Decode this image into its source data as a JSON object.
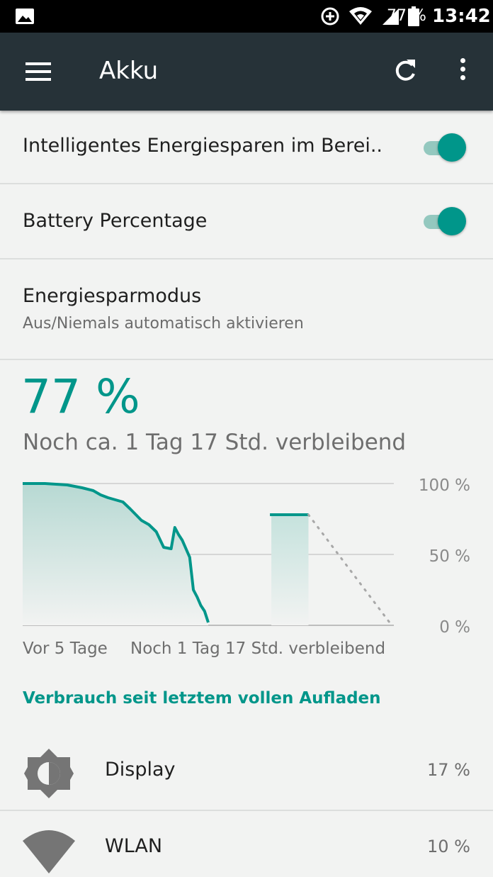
{
  "status_bar": {
    "battery_percent": "77 %",
    "time": "13:42",
    "icons": [
      "image-icon",
      "data-saver-icon",
      "wifi-icon",
      "signal-icon",
      "battery-icon"
    ]
  },
  "app_bar": {
    "title": "Akku",
    "icons": [
      "menu-icon",
      "refresh-icon",
      "more-vert-icon"
    ]
  },
  "settings": {
    "smart_power": {
      "label": "Intelligentes Energiesparen im Berei..",
      "enabled": true
    },
    "battery_percentage": {
      "label": "Battery Percentage",
      "enabled": true
    },
    "power_saver": {
      "title": "Energiesparmodus",
      "subtitle": "Aus/Niemals automatisch aktivieren"
    }
  },
  "battery": {
    "percent": "77 %",
    "remaining": "Noch ca. 1 Tag 17 Std. verbleibend"
  },
  "chart_data": {
    "type": "area",
    "x_label_left": "Vor 5 Tage",
    "x_label_right": "Noch 1 Tag 17 Std. verbleibend",
    "y_tick_labels": [
      "100 %",
      "50 %",
      "0 %"
    ],
    "ylim": [
      0,
      100
    ],
    "grid": true,
    "history": {
      "x": [
        0,
        6,
        12,
        16,
        19,
        21,
        23,
        27,
        29,
        32,
        34,
        36,
        38,
        40,
        41,
        42,
        43,
        45,
        46,
        47,
        48,
        49,
        50
      ],
      "y": [
        100,
        100,
        99,
        97,
        95,
        92,
        90,
        87,
        82,
        74,
        71,
        66,
        55,
        54,
        69,
        64,
        60,
        48,
        25,
        20,
        14,
        10,
        2
      ]
    },
    "current_level_range": {
      "x": [
        67,
        77
      ],
      "y": 78
    },
    "projection": {
      "x": [
        77,
        100
      ],
      "y": [
        78,
        2
      ],
      "style": "dotted"
    },
    "color": "#00968a"
  },
  "usage": {
    "section_title": "Verbrauch seit letztem vollen Aufladen",
    "items": [
      {
        "label": "Display",
        "percent": "17 %",
        "icon": "brightness-icon"
      },
      {
        "label": "WLAN",
        "percent": "10 %",
        "icon": "wifi-icon"
      }
    ]
  },
  "colors": {
    "accent": "#00968a",
    "app_bar": "#263238",
    "background": "#f2f3f2"
  }
}
